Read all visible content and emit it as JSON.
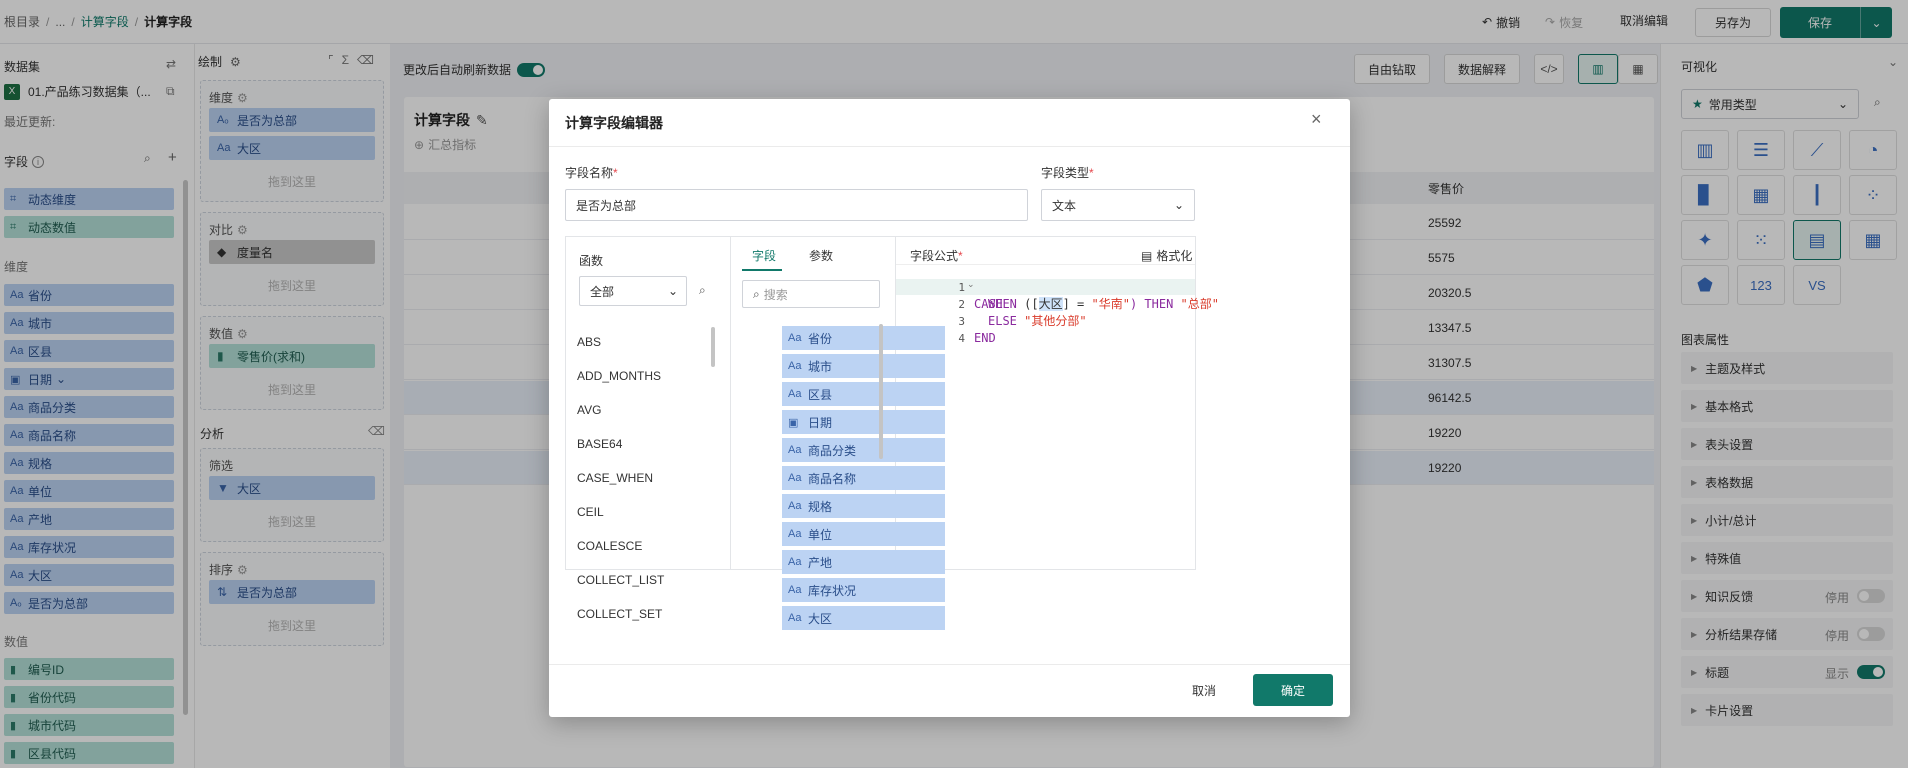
{
  "breadcrumb": {
    "root": "根目录",
    "ellipsis": "...",
    "parent": "计算字段",
    "current": "计算字段"
  },
  "toolbar": {
    "undo": "撤销",
    "redo": "恢复",
    "cancel_edit": "取消编辑",
    "save_as": "另存为",
    "save": "保存"
  },
  "left": {
    "dataset_title": "数据集",
    "dataset_name": "01.产品练习数据集（...",
    "last_update": "最近更新:",
    "fields_title": "字段",
    "dynamic": [
      "动态维度",
      "动态数值"
    ],
    "dimension_title": "维度",
    "dimensions": [
      "省份",
      "城市",
      "区县",
      "日期",
      "商品分类",
      "商品名称",
      "规格",
      "单位",
      "产地",
      "库存状况",
      "大区",
      "是否为总部"
    ],
    "measure_title": "数值",
    "measures": [
      "编号ID",
      "省份代码",
      "城市代码",
      "区县代码"
    ]
  },
  "mid": {
    "draw_title": "绘制",
    "dim_title": "维度",
    "dim_items": [
      "是否为总部",
      "大区"
    ],
    "compare_title": "对比",
    "compare_item": "度量名",
    "value_title": "数值",
    "value_item": "零售价(求和)",
    "analysis_title": "分析",
    "filter_title": "筛选",
    "filter_item": "大区",
    "sort_title": "排序",
    "sort_item": "是否为总部",
    "drop_hint": "拖到这里"
  },
  "canvas": {
    "auto_refresh": "更改后自动刷新数据",
    "drill": "自由钻取",
    "explain": "数据解释",
    "card_title": "计算字段",
    "summary": "汇总指标",
    "col_header": "零售价",
    "values": [
      "25592",
      "5575",
      "20320.5",
      "13347.5",
      "31307.5",
      "96142.5",
      "19220",
      "19220"
    ]
  },
  "right": {
    "viz_title": "可视化",
    "chart_type": "常用类型",
    "props_title": "图表属性",
    "props": [
      {
        "label": "主题及样式"
      },
      {
        "label": "基本格式"
      },
      {
        "label": "表头设置"
      },
      {
        "label": "表格数据"
      },
      {
        "label": "小计/总计"
      },
      {
        "label": "特殊值"
      },
      {
        "label": "知识反馈",
        "state": "停用",
        "on": false
      },
      {
        "label": "分析结果存储",
        "state": "停用",
        "on": false
      },
      {
        "label": "标题",
        "state": "显示",
        "on": true
      },
      {
        "label": "卡片设置"
      }
    ],
    "kpi_label": "123"
  },
  "modal": {
    "title": "计算字段编辑器",
    "name_label": "字段名称",
    "name_value": "是否为总部",
    "type_label": "字段类型",
    "type_value": "文本",
    "func_title": "函数",
    "func_filter": "全部",
    "functions": [
      "ABS",
      "ADD_MONTHS",
      "AVG",
      "BASE64",
      "CASE_WHEN",
      "CEIL",
      "COALESCE",
      "COLLECT_LIST",
      "COLLECT_SET"
    ],
    "tab_fields": "字段",
    "tab_params": "参数",
    "search_placeholder": "搜索",
    "fields": [
      "省份",
      "城市",
      "区县",
      "日期",
      "商品分类",
      "商品名称",
      "规格",
      "单位",
      "产地",
      "库存状况",
      "大区"
    ],
    "formula_title": "字段公式",
    "format": "格式化",
    "code": {
      "l1": "CASE",
      "l2_when": "WHEN",
      "l2_open": "([",
      "l2_field": "大区",
      "l2_mid": "] = ",
      "l2_str": "\"华南\"",
      "l2_then": ") THEN ",
      "l2_val": "\"总部\"",
      "l3_else": "ELSE ",
      "l3_val": "\"其他分部\"",
      "l4": "END"
    },
    "line_numbers": [
      "1",
      "2",
      "3",
      "4"
    ],
    "cancel": "取消",
    "ok": "确定"
  }
}
